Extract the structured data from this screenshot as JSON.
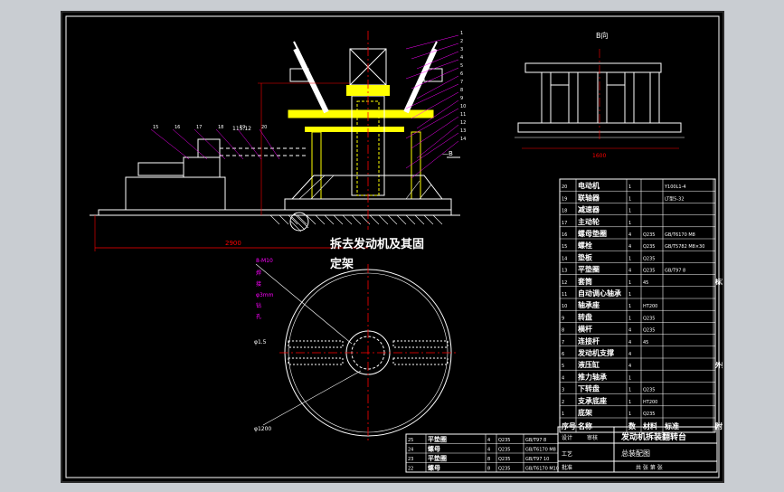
{
  "drawing": {
    "main_title": "拆去发动机及其固定架",
    "view_b_label": "B向",
    "section_mark": "—B",
    "dims": {
      "overall_width": "2900",
      "view_b_width": "1600",
      "bolt_note": "8-M10",
      "phi_outer": "φ1200",
      "phi_left": "φ1.5",
      "side_dim": "115.12"
    },
    "left_side_notes": [
      "焊",
      "接",
      "φ3mm",
      "钻",
      "孔"
    ],
    "leader_numbers": [
      "1",
      "2",
      "3",
      "4",
      "5",
      "6",
      "7",
      "8",
      "9",
      "10",
      "11",
      "12",
      "13",
      "14",
      "15",
      "16",
      "17",
      "18",
      "19",
      "20"
    ]
  },
  "parts_list": {
    "headers": {
      "no": "序号",
      "name": "名称",
      "qty": "数",
      "material": "材料",
      "std": "标准",
      "note": "附注"
    },
    "rows": [
      {
        "no": "20",
        "name": "电动机",
        "qty": "1",
        "mat": "",
        "std": "Y100L1-4",
        "note": ""
      },
      {
        "no": "19",
        "name": "联轴器",
        "qty": "1",
        "mat": "",
        "std": "LT型5-32",
        "note": ""
      },
      {
        "no": "18",
        "name": "减速器",
        "qty": "1",
        "mat": "",
        "std": "",
        "note": ""
      },
      {
        "no": "17",
        "name": "主动轮",
        "qty": "1",
        "mat": "",
        "std": "",
        "note": ""
      },
      {
        "no": "16",
        "name": "螺母垫圈",
        "qty": "4",
        "mat": "Q235",
        "std": "GB/T6170 M8",
        "note": ""
      },
      {
        "no": "15",
        "name": "螺栓",
        "qty": "4",
        "mat": "Q235",
        "std": "GB/T5782 M8×30",
        "note": ""
      },
      {
        "no": "14",
        "name": "垫板",
        "qty": "1",
        "mat": "Q235",
        "std": "",
        "note": ""
      },
      {
        "no": "13",
        "name": "平垫圈",
        "qty": "4",
        "mat": "Q235",
        "std": "GB/T97 8",
        "note": ""
      },
      {
        "no": "12",
        "name": "套筒",
        "qty": "1",
        "mat": "45",
        "std": "",
        "note": "标准件"
      },
      {
        "no": "11",
        "name": "自动调心轴承",
        "qty": "1",
        "mat": "",
        "std": "",
        "note": ""
      },
      {
        "no": "10",
        "name": "轴承座",
        "qty": "1",
        "mat": "HT200",
        "std": "",
        "note": ""
      },
      {
        "no": "9",
        "name": "转盘",
        "qty": "1",
        "mat": "Q235",
        "std": "",
        "note": ""
      },
      {
        "no": "8",
        "name": "横杆",
        "qty": "4",
        "mat": "Q235",
        "std": "",
        "note": ""
      },
      {
        "no": "7",
        "name": "连接杆",
        "qty": "4",
        "mat": "45",
        "std": "",
        "note": ""
      },
      {
        "no": "6",
        "name": "发动机支撑",
        "qty": "4",
        "mat": "",
        "std": "",
        "note": ""
      },
      {
        "no": "5",
        "name": "液压缸",
        "qty": "4",
        "mat": "",
        "std": "",
        "note": "外购"
      },
      {
        "no": "4",
        "name": "推力轴承",
        "qty": "1",
        "mat": "",
        "std": "",
        "note": ""
      },
      {
        "no": "3",
        "name": "下转盘",
        "qty": "1",
        "mat": "Q235",
        "std": "",
        "note": ""
      },
      {
        "no": "2",
        "name": "支承底座",
        "qty": "1",
        "mat": "HT200",
        "std": "",
        "note": ""
      },
      {
        "no": "1",
        "name": "底架",
        "qty": "1",
        "mat": "Q235",
        "std": "",
        "note": ""
      }
    ],
    "lower_rows": [
      {
        "no": "25",
        "name": "平垫圈",
        "qty": "4",
        "mat": "Q235",
        "std": "GB/T97 8"
      },
      {
        "no": "24",
        "name": "螺母",
        "qty": "4",
        "mat": "Q235",
        "std": "GB/T6170 M8"
      },
      {
        "no": "23",
        "name": "平垫圈",
        "qty": "8",
        "mat": "Q235",
        "std": "GB/T97 10"
      },
      {
        "no": "22",
        "name": "螺母",
        "qty": "8",
        "mat": "Q235",
        "std": "GB/T6170 M10"
      }
    ]
  },
  "title_block": {
    "title": "发动机拆装翻转台",
    "subtitle": "总装配图",
    "sheet": "共 张 第 张",
    "labels": [
      "设计",
      "审核",
      "工艺",
      "批准"
    ]
  },
  "colors": {
    "background": "#000000",
    "line": "#ffffff",
    "part": "#ffff00",
    "dimension": "#ff0000",
    "leader": "#ff00ff",
    "center": "#ff0000",
    "hatch": "#ffffff"
  }
}
